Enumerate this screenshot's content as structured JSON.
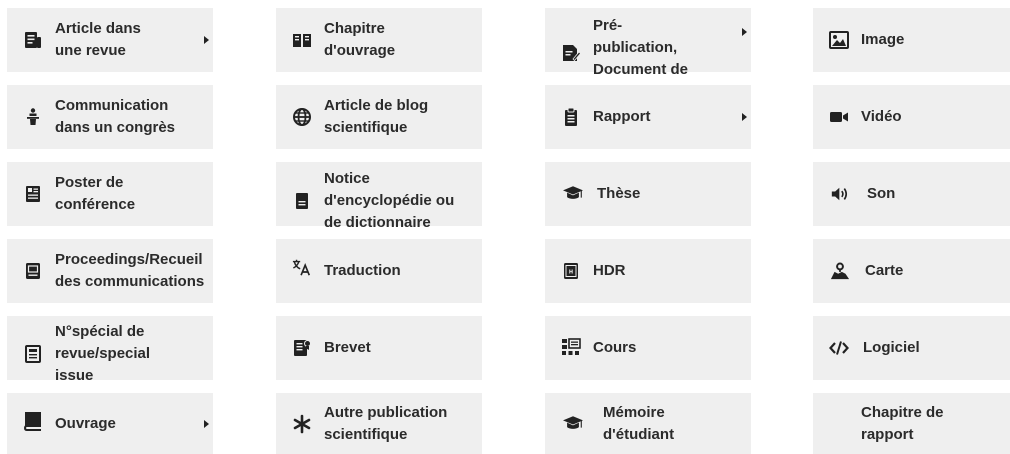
{
  "items": [
    {
      "label": "Article dans une revue",
      "icon": "article-icon",
      "submenu": true
    },
    {
      "label": "Chapitre d'ouvrage",
      "icon": "open-book-icon",
      "submenu": false
    },
    {
      "label": "Pré-publication, Document de",
      "icon": "preprint-icon",
      "submenu": true
    },
    {
      "label": "Image",
      "icon": "image-icon",
      "submenu": false
    },
    {
      "label": "Communication dans un congrès",
      "icon": "lectern-icon",
      "submenu": false
    },
    {
      "label": "Article de blog scientifique",
      "icon": "globe-icon",
      "submenu": false
    },
    {
      "label": "Rapport",
      "icon": "clipboard-icon",
      "submenu": true
    },
    {
      "label": "Vidéo",
      "icon": "video-camera-icon",
      "submenu": false
    },
    {
      "label": "Poster de conférence",
      "icon": "poster-icon",
      "submenu": false
    },
    {
      "label": "Notice d'encyclopédie ou de dictionnaire",
      "icon": "document-icon",
      "submenu": false
    },
    {
      "label": "Thèse",
      "icon": "graduation-cap-icon",
      "submenu": false
    },
    {
      "label": "Son",
      "icon": "speaker-icon",
      "submenu": false
    },
    {
      "label": "Proceedings/Recueil des communications",
      "icon": "proceedings-icon",
      "submenu": false
    },
    {
      "label": "Traduction",
      "icon": "translate-icon",
      "submenu": false
    },
    {
      "label": "HDR",
      "icon": "hdr-icon",
      "submenu": false
    },
    {
      "label": "Carte",
      "icon": "map-pin-icon",
      "submenu": false
    },
    {
      "label": "N°spécial de revue/special issue",
      "icon": "special-issue-icon",
      "submenu": false
    },
    {
      "label": "Brevet",
      "icon": "patent-icon",
      "submenu": false
    },
    {
      "label": "Cours",
      "icon": "course-icon",
      "submenu": false
    },
    {
      "label": "Logiciel",
      "icon": "code-icon",
      "submenu": false
    },
    {
      "label": "Ouvrage",
      "icon": "book-icon",
      "submenu": true
    },
    {
      "label": "Autre publication scientifique",
      "icon": "asterisk-icon",
      "submenu": false
    },
    {
      "label": "Mémoire d'étudiant",
      "icon": "graduation-cap-icon",
      "submenu": false
    },
    {
      "label": "Chapitre de rapport",
      "icon": "",
      "submenu": false
    }
  ]
}
